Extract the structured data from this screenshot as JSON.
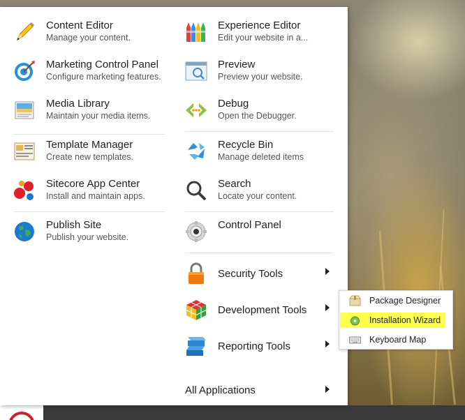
{
  "menu": {
    "left_column": [
      {
        "title": "Content Editor",
        "desc": "Manage your content.",
        "icon": "pencil-icon"
      },
      {
        "title": "Marketing Control Panel",
        "desc": "Configure marketing features.",
        "icon": "target-icon"
      },
      {
        "title": "Media Library",
        "desc": "Maintain your media items.",
        "icon": "media-library-icon"
      },
      {
        "title": "Template Manager",
        "desc": "Create new templates.",
        "icon": "template-icon"
      },
      {
        "title": "Sitecore App Center",
        "desc": "Install and maintain apps.",
        "icon": "app-center-icon"
      },
      {
        "title": "Publish Site",
        "desc": "Publish your website.",
        "icon": "globe-icon"
      }
    ],
    "right_column": [
      {
        "title": "Experience Editor",
        "desc": "Edit your website in a...",
        "icon": "crayons-icon"
      },
      {
        "title": "Preview",
        "desc": "Preview your website.",
        "icon": "preview-icon"
      },
      {
        "title": "Debug",
        "desc": "Open the Debugger.",
        "icon": "debug-icon"
      },
      {
        "title": "Recycle Bin",
        "desc": "Manage deleted items",
        "icon": "recycle-icon"
      },
      {
        "title": "Search",
        "desc": "Locate your content.",
        "icon": "magnifier-icon"
      },
      {
        "title": "Control Panel",
        "desc": "",
        "icon": "gear-icon"
      }
    ],
    "tools": [
      {
        "title": "Security Tools",
        "icon": "padlock-icon"
      },
      {
        "title": "Development Tools",
        "icon": "rubiks-cube-icon"
      },
      {
        "title": "Reporting Tools",
        "icon": "reporting-icon"
      }
    ],
    "all_applications": "All Applications"
  },
  "submenu": {
    "items": [
      {
        "title": "Package Designer",
        "icon": "package-icon"
      },
      {
        "title": "Installation Wizard",
        "icon": "cd-install-icon",
        "highlighted": true
      },
      {
        "title": "Keyboard Map",
        "icon": "keyboard-icon"
      }
    ]
  },
  "colors": {
    "highlight": "#fdff4a",
    "start_button": "#d0202a"
  }
}
